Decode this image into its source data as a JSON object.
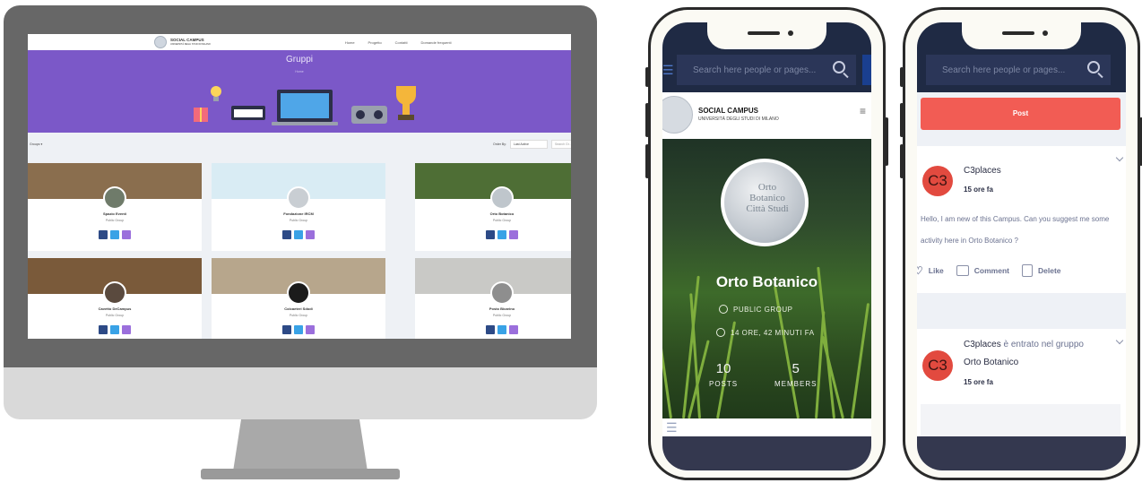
{
  "desktop": {
    "nav": {
      "logo_name": "SOCIAL CAMPUS",
      "logo_sub": "UNIVERSITÀ DEGLI STUDI DI MILANO",
      "menu": [
        "Home",
        "Progetto",
        "Contatti",
        "Domande frequenti"
      ]
    },
    "hero": {
      "title": "Gruppi",
      "subtitle": "Home"
    },
    "filter": {
      "left": "Groups ▾",
      "sort_label": "Order By:",
      "sort_value": "Last Active",
      "search_placeholder": "Search Gr..."
    },
    "groups": [
      {
        "name": "Spazio Eventi",
        "type": "Public Group",
        "img_color": "#8a6e4e",
        "avatar_color": "#6f7b6a"
      },
      {
        "name": "Fondazione IRCM",
        "type": "Public Group",
        "img_color": "#d9ecf4",
        "avatar_color": "#c9ced3"
      },
      {
        "name": "Orto Botanico",
        "type": "Public Group",
        "img_color": "#4e6e35",
        "avatar_color": "#bfc6cc"
      },
      {
        "name": "Cavetto DeCampus",
        "type": "Public Group",
        "img_color": "#7a5a3a",
        "avatar_color": "#5a4a3e"
      },
      {
        "name": "Colcaeteri Sdodi",
        "type": "Public Group",
        "img_color": "#b7a68c",
        "avatar_color": "#1b1b1b"
      },
      {
        "name": "Posto Bicarino",
        "type": "Public Group",
        "img_color": "#c9c9c6",
        "avatar_color": "#8e8e8e"
      }
    ]
  },
  "phone1": {
    "search_placeholder": "Search here people or pages...",
    "header": {
      "name": "SOCIAL CAMPUS",
      "university": "UNIVERSITÀ DEGLI STUDI DI MILANO"
    },
    "group": {
      "avatar_text": "Orto Botanico Città Studi",
      "title": "Orto Botanico",
      "type": "PUBLIC GROUP",
      "last_active": "14 ORE, 42 MINUTI FA",
      "posts_count": "10",
      "posts_label": "POSTS",
      "members_count": "5",
      "members_label": "MEMBERS"
    }
  },
  "phone2": {
    "search_placeholder": "Search here people or pages...",
    "post_button": "Post",
    "activities": [
      {
        "avatar": "C3",
        "user": "C3places",
        "time": "15 ore fa",
        "text": "Hello, I am new of this Campus. Can you suggest me some activity here in Orto Botanico ?",
        "actions": {
          "like": "Like",
          "comment": "Comment",
          "delete": "Delete"
        }
      },
      {
        "avatar": "C3",
        "user": "C3places",
        "event": "è entrato nel gruppo",
        "group": "Orto Botanico",
        "time": "15 ore fa"
      }
    ]
  },
  "colors": {
    "hero_purple": "#7b58c8",
    "post_red": "#f25c54",
    "navy": "#1f2a44",
    "avatar_red": "#e24a3f"
  }
}
